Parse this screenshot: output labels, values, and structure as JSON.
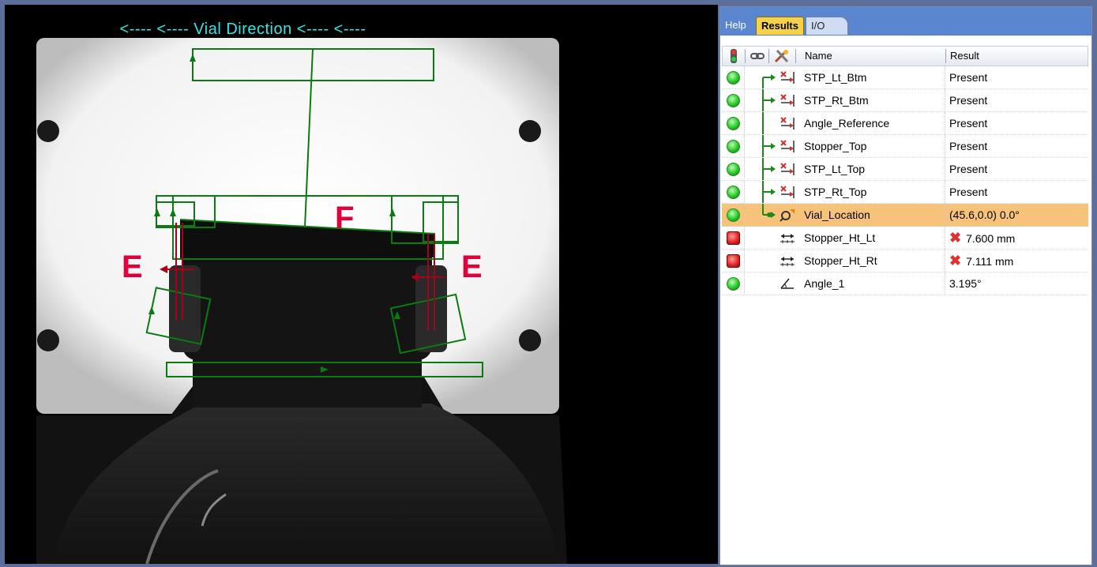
{
  "image_view": {
    "direction_caption": "<----  <----  Vial Direction  <----  <----",
    "labels": {
      "left": "E",
      "right": "E",
      "top": "F"
    }
  },
  "tabs": [
    {
      "label": "Help",
      "active": false
    },
    {
      "label": "Results",
      "active": true
    },
    {
      "label": "I/O",
      "active": false
    }
  ],
  "grid": {
    "columns": {
      "name": "Name",
      "result": "Result"
    },
    "header_icons": [
      "status-light-icon",
      "link-icon",
      "tools-icon"
    ],
    "rows": [
      {
        "status": "pass",
        "icon": "edge-tool-icon",
        "name": "STP_Lt_Btm",
        "result": "Present",
        "fail": false,
        "selected": false
      },
      {
        "status": "pass",
        "icon": "edge-tool-icon",
        "name": "STP_Rt_Btm",
        "result": "Present",
        "fail": false,
        "selected": false
      },
      {
        "status": "pass",
        "icon": "edge-tool-icon",
        "name": "Angle_Reference",
        "result": "Present",
        "fail": false,
        "selected": false
      },
      {
        "status": "pass",
        "icon": "edge-tool-icon",
        "name": "Stopper_Top",
        "result": "Present",
        "fail": false,
        "selected": false
      },
      {
        "status": "pass",
        "icon": "edge-tool-icon",
        "name": "STP_Lt_Top",
        "result": "Present",
        "fail": false,
        "selected": false
      },
      {
        "status": "pass",
        "icon": "edge-tool-icon",
        "name": "STP_Rt_Top",
        "result": "Present",
        "fail": false,
        "selected": false
      },
      {
        "status": "pass",
        "icon": "locate-tool-icon",
        "name": "Vial_Location",
        "result": "(45.6,0.0) 0.0°",
        "fail": false,
        "selected": true
      },
      {
        "status": "fail",
        "icon": "distance-tool-icon",
        "name": "Stopper_Ht_Lt",
        "result": "7.600 mm",
        "fail": true,
        "selected": false
      },
      {
        "status": "fail",
        "icon": "distance-tool-icon",
        "name": "Stopper_Ht_Rt",
        "result": "7.111 mm",
        "fail": true,
        "selected": false
      },
      {
        "status": "pass",
        "icon": "angle-tool-icon",
        "name": "Angle_1",
        "result": "3.195°",
        "fail": false,
        "selected": false
      }
    ]
  },
  "colors": {
    "overlay_green": "#0a7a12",
    "marker_red": "#e0003a",
    "caption_cyan": "#33e6e6",
    "selected_row": "#f7c27a",
    "tab_strip": "#5a86cf",
    "active_tab": "#f5d24a"
  }
}
